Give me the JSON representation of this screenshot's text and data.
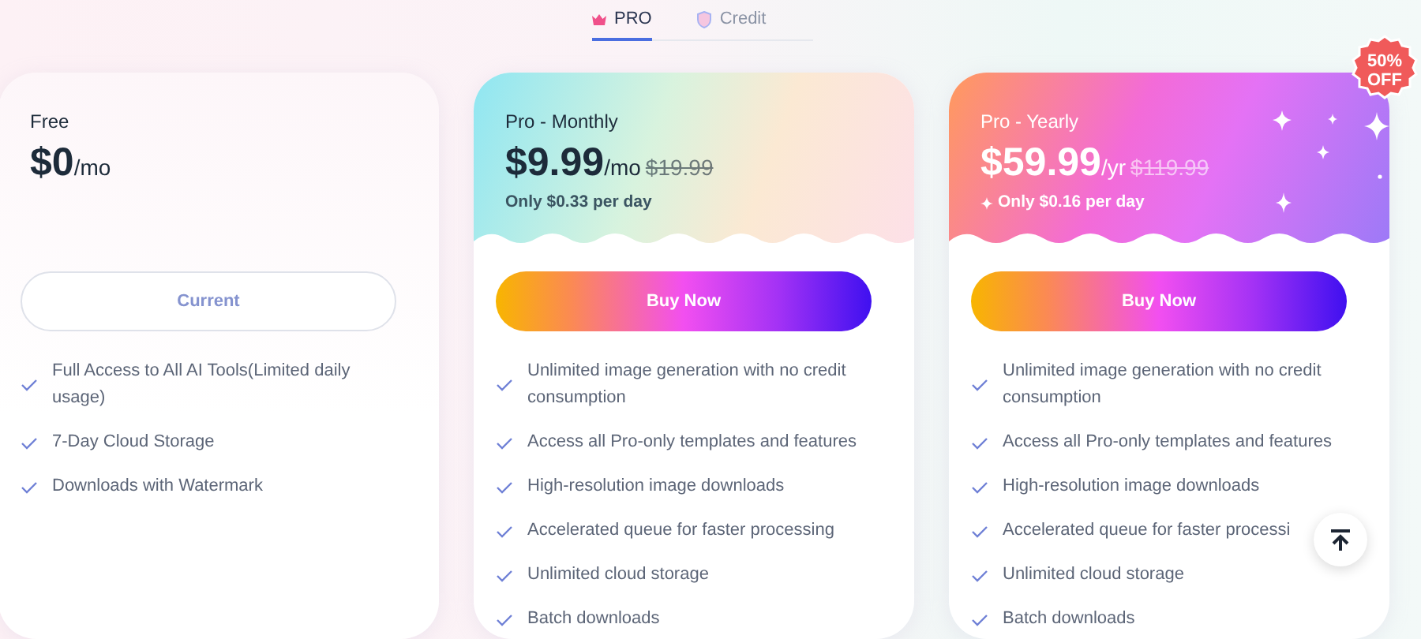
{
  "tabs": [
    {
      "kind": "pro",
      "label": "PRO",
      "selected": true
    },
    {
      "kind": "credit",
      "label": "Credit",
      "selected": false
    }
  ],
  "plans": [
    {
      "kind": "free",
      "name": "Free",
      "price": "$0",
      "period": "/mo",
      "button": "Current",
      "features": [
        "Full Access to All AI Tools(Limited daily usage)",
        "7-Day Cloud Storage",
        "Downloads with Watermark"
      ]
    },
    {
      "kind": "monthly",
      "name": "Pro - Monthly",
      "price": "$9.99",
      "period": "/mo",
      "original_price": "$19.99",
      "per_day": "Only $0.33 per day",
      "button": "Buy Now",
      "features": [
        "Unlimited image generation with no credit consumption",
        "Access all Pro-only templates and features",
        "High-resolution image downloads",
        "Accelerated queue for faster processing",
        "Unlimited cloud storage",
        "Batch downloads"
      ]
    },
    {
      "kind": "yearly",
      "name": "Pro - Yearly",
      "price": "$59.99",
      "period": "/yr",
      "original_price": "$119.99",
      "per_day": "Only $0.16 per day",
      "badge": "50% OFF",
      "button": "Buy Now",
      "features": [
        "Unlimited image generation with no credit consumption",
        "Access all Pro-only templates and features",
        "High-resolution image downloads",
        "Accelerated queue for faster processi",
        "Unlimited cloud storage",
        "Batch downloads"
      ]
    }
  ]
}
